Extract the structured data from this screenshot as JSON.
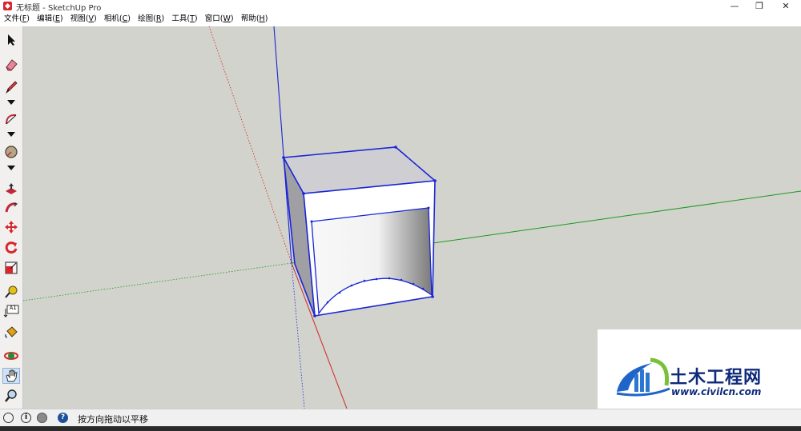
{
  "window": {
    "title": "无标题 - SketchUp Pro",
    "minimize_glyph": "—",
    "restore_glyph": "❐",
    "close_glyph": "✕"
  },
  "menu": [
    {
      "label": "文件(",
      "key": "F",
      "end": ")"
    },
    {
      "label": "编辑(",
      "key": "E",
      "end": ")"
    },
    {
      "label": "视图(",
      "key": "V",
      "end": ")"
    },
    {
      "label": "相机(",
      "key": "C",
      "end": ")"
    },
    {
      "label": "绘图(",
      "key": "R",
      "end": ")"
    },
    {
      "label": "工具(",
      "key": "T",
      "end": ")"
    },
    {
      "label": "窗口(",
      "key": "W",
      "end": ")"
    },
    {
      "label": "帮助(",
      "key": "H",
      "end": ")"
    }
  ],
  "toolbar": {
    "icons": [
      "select-arrow",
      "eraser",
      "pencil-line",
      "dropdown",
      "arc",
      "dropdown",
      "protractor-shape",
      "dropdown",
      "push-pull",
      "follow-me",
      "move",
      "rotate",
      "scale",
      "tape-measure",
      "text-label",
      "paint-bucket",
      "orbit",
      "pan",
      "zoom"
    ],
    "active": "pan",
    "text_tool_label": "A1"
  },
  "status": {
    "message": "按方向拖动以平移",
    "help_glyph": "?",
    "info_glyph": "i"
  },
  "watermark": {
    "title": "土木工程网",
    "url": "www.civilcn.com"
  },
  "colors": {
    "viewport_bg": "#d1d3cc",
    "axis_red": "#d42424",
    "axis_green": "#1d9a1d",
    "axis_blue": "#1a24d6",
    "selection_blue": "#1a24d6",
    "watermark_blue": "#0e2a7a"
  }
}
